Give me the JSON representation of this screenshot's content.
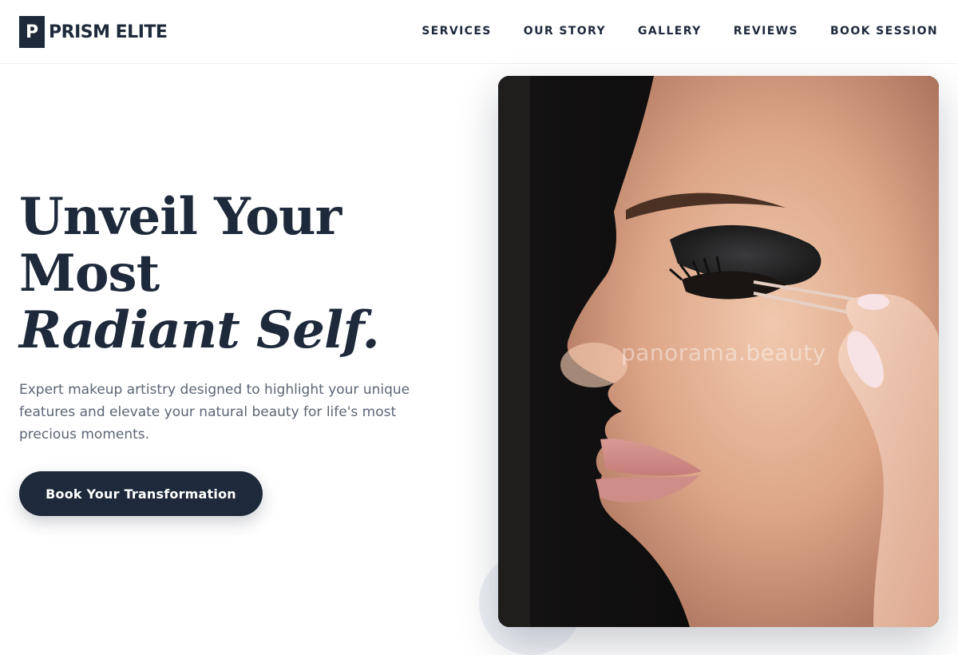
{
  "brand": {
    "logo_letter": "P",
    "name": "PRISM ELITE",
    "primary_color": "#1e293b"
  },
  "nav": {
    "items": [
      {
        "label": "SERVICES"
      },
      {
        "label": "OUR STORY"
      },
      {
        "label": "GALLERY"
      },
      {
        "label": "REVIEWS"
      },
      {
        "label": "BOOK SESSION"
      }
    ]
  },
  "hero": {
    "title_line1": "Unveil Your",
    "title_line2": "Most",
    "title_line3": "Radiant Self.",
    "description": "Expert makeup artistry designed to highlight your unique features and elevate your natural beauty for life's most precious moments.",
    "cta_label": "Book Your Transformation",
    "image": {
      "subject": "close-up profile of a woman having false eyelashes applied with tweezers",
      "watermark": "panorama.beauty"
    }
  }
}
